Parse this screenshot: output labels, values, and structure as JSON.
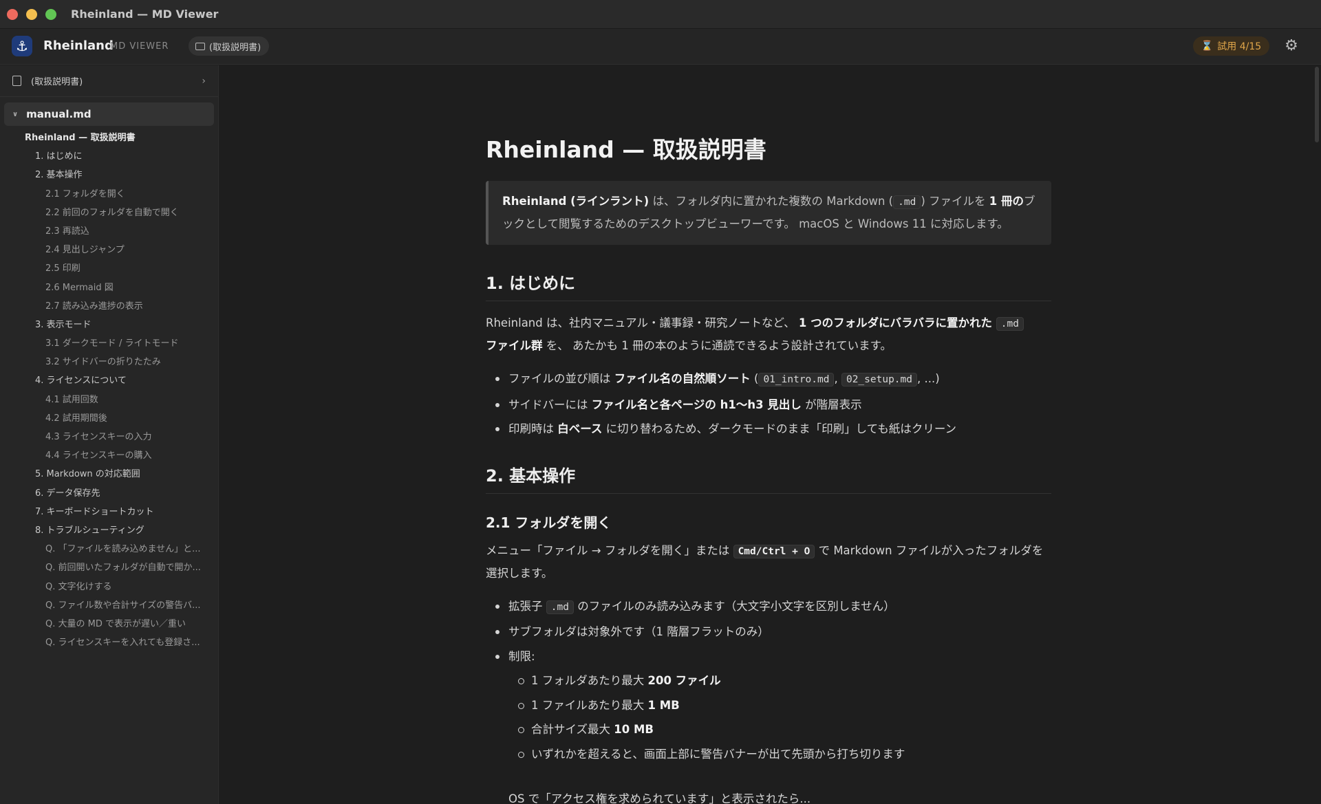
{
  "window": {
    "title": "Rheinland — MD Viewer"
  },
  "appbar": {
    "brand": "Rheinland",
    "subbrand": "MD VIEWER",
    "folder": "(取扱説明書)",
    "trial": "試用 4/15"
  },
  "sidebar": {
    "folder": "(取扱説明書)",
    "file": "manual.md",
    "toc": [
      {
        "level": 1,
        "label": "Rheinland — 取扱説明書"
      },
      {
        "level": 2,
        "label": "1. はじめに"
      },
      {
        "level": 2,
        "label": "2. 基本操作"
      },
      {
        "level": 3,
        "label": "2.1 フォルダを開く"
      },
      {
        "level": 3,
        "label": "2.2 前回のフォルダを自動で開く"
      },
      {
        "level": 3,
        "label": "2.3 再読込"
      },
      {
        "level": 3,
        "label": "2.4 見出しジャンプ"
      },
      {
        "level": 3,
        "label": "2.5 印刷"
      },
      {
        "level": 3,
        "label": "2.6 Mermaid 図"
      },
      {
        "level": 3,
        "label": "2.7 読み込み進捗の表示"
      },
      {
        "level": 2,
        "label": "3. 表示モード"
      },
      {
        "level": 3,
        "label": "3.1 ダークモード / ライトモード"
      },
      {
        "level": 3,
        "label": "3.2 サイドバーの折りたたみ"
      },
      {
        "level": 2,
        "label": "4. ライセンスについて"
      },
      {
        "level": 3,
        "label": "4.1 試用回数"
      },
      {
        "level": 3,
        "label": "4.2 試用期間後"
      },
      {
        "level": 3,
        "label": "4.3 ライセンスキーの入力"
      },
      {
        "level": 3,
        "label": "4.4 ライセンスキーの購入"
      },
      {
        "level": 2,
        "label": "5. Markdown の対応範囲"
      },
      {
        "level": 2,
        "label": "6. データ保存先"
      },
      {
        "level": 2,
        "label": "7. キーボードショートカット"
      },
      {
        "level": 2,
        "label": "8. トラブルシューティング"
      },
      {
        "level": 3,
        "label": "Q. 「ファイルを読み込めません」と..."
      },
      {
        "level": 3,
        "label": "Q. 前回開いたフォルダが自動で開か..."
      },
      {
        "level": 3,
        "label": "Q. 文字化けする"
      },
      {
        "level": 3,
        "label": "Q. ファイル数や合計サイズの警告バ..."
      },
      {
        "level": 3,
        "label": "Q. 大量の MD で表示が遅い／重い"
      },
      {
        "level": 3,
        "label": "Q. ライセンスキーを入れても登録さ..."
      }
    ]
  },
  "doc": {
    "h1": "Rheinland — 取扱説明書",
    "note": {
      "b1": "Rheinland (ラインラント)",
      "t1": " は、フォルダ内に置かれた複数の Markdown (",
      "c1": ".md",
      "t2": ") ファイルを ",
      "b2": "1 冊の",
      "t3": "ブックとして閲覧するためのデスクトップビューワーです。 macOS と Windows 11 に対応します。"
    },
    "s1": {
      "h2": "1. はじめに",
      "p": {
        "t1": "Rheinland は、社内マニュアル・議事録・研究ノートなど、 ",
        "b1": "1 つのフォルダにバラバラに置かれた ",
        "c1": ".md",
        "b2": "ファイル群",
        "t2": " を、 あたかも 1 冊の本のように通読できるよう設計されています。"
      },
      "li1": {
        "t1": "ファイルの並び順は ",
        "b1": "ファイル名の自然順ソート",
        "t2": " (",
        "c1": "01_intro.md",
        "t3": ", ",
        "c2": "02_setup.md",
        "t4": ", ...)"
      },
      "li2": {
        "t1": "サイドバーには ",
        "b1": "ファイル名と各ページの h1〜h3 見出し",
        "t2": " が階層表示"
      },
      "li3": {
        "t1": "印刷時は ",
        "b1": "白ベース",
        "t2": " に切り替わるため、ダークモードのまま「印刷」しても紙はクリーン"
      }
    },
    "s2": {
      "h2": "2. 基本操作",
      "h3": "2.1 フォルダを開く",
      "p": {
        "t1": "メニュー「ファイル → フォルダを開く」または ",
        "c1": "Cmd/Ctrl + O",
        "t2": " で Markdown ファイルが入ったフォルダを選択します。"
      },
      "li1": {
        "t1": "拡張子 ",
        "c1": ".md",
        "t2": " のファイルのみ読み込みます（大文字小文字を区別しません）"
      },
      "li2": "サブフォルダは対象外です（1 階層フラットのみ）",
      "li3": "制限:",
      "sub1": {
        "t1": "1 フォルダあたり最大 ",
        "b1": "200 ファイル"
      },
      "sub2": {
        "t1": "1 ファイルあたり最大 ",
        "b1": "1 MB"
      },
      "sub3": {
        "t1": "合計サイズ最大 ",
        "b1": "10 MB"
      },
      "sub4": "いずれかを超えると、画面上部に警告バナーが出て先頭から打ち切ります",
      "cut": "OS で「アクセス権を求められています」と表示されたら..."
    }
  }
}
